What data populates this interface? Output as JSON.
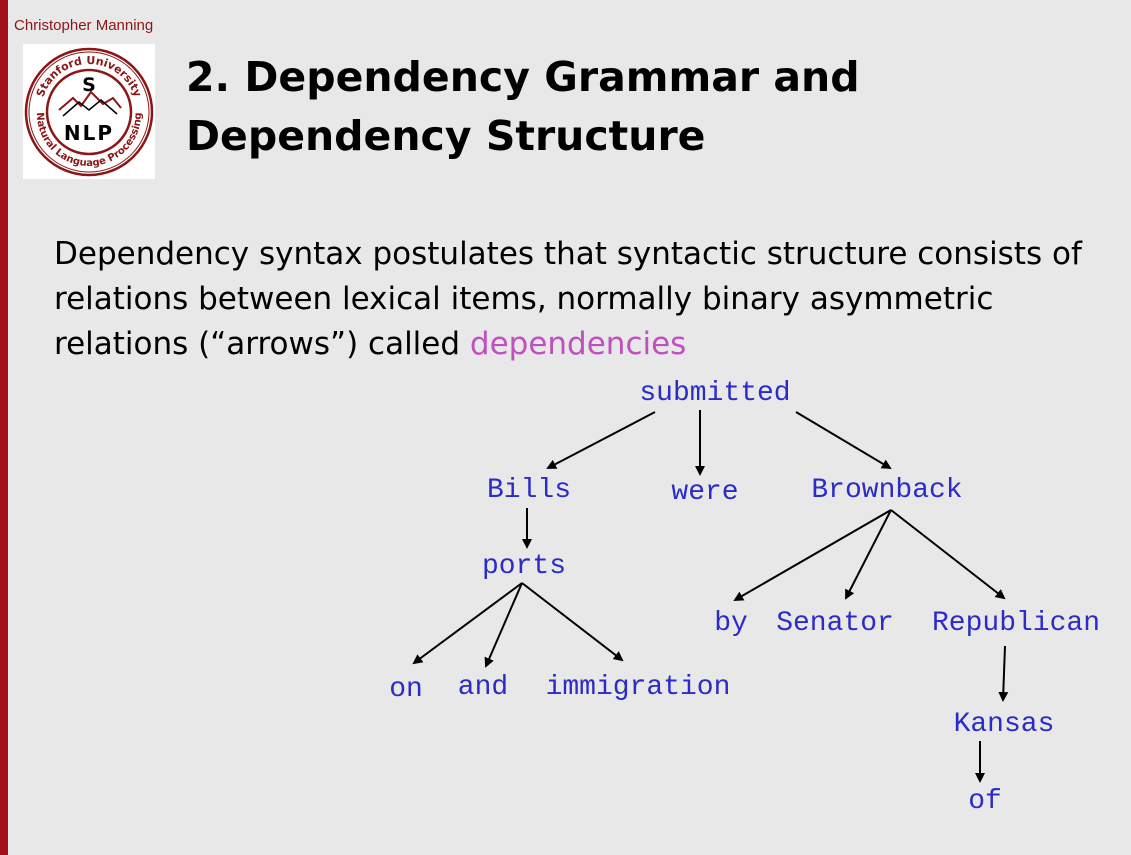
{
  "header": {
    "author": "Christopher Manning",
    "title_line1": "2. Dependency Grammar and",
    "title_line2": "Dependency Structure"
  },
  "logo": {
    "top_text": "Stanford University",
    "bottom_text": "Natural Language Processing",
    "letter": "S",
    "nlp": "NLP"
  },
  "body": {
    "text": "Dependency syntax postulates that syntactic structure consists of relations between lexical items, normally binary asymmetric relations (“arrows”) called ",
    "highlight": "dependencies"
  },
  "tree": {
    "words": {
      "submitted": "submitted",
      "bills": "Bills",
      "were": "were",
      "brownback": "Brownback",
      "ports": "ports",
      "on": "on",
      "and": "and",
      "immigration": "immigration",
      "by": "by",
      "senator": "Senator",
      "republican": "Republican",
      "kansas": "Kansas",
      "of": "of"
    }
  },
  "colors": {
    "accent": "#a10f1b",
    "highlight": "#c04fc0",
    "tree_words": "#2b2bc8",
    "background": "#e8e8e8"
  }
}
